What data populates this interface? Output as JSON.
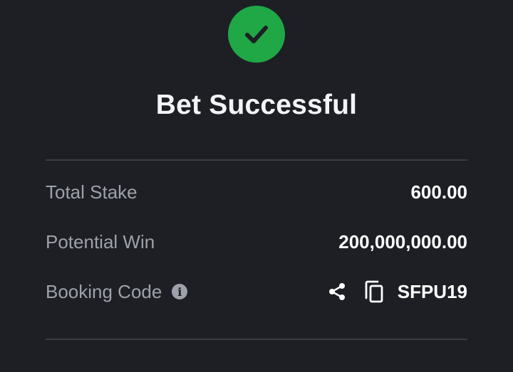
{
  "status": {
    "title": "Bet Successful",
    "icon": "check-circle-icon",
    "accent_color": "#1fa845"
  },
  "details": {
    "total_stake": {
      "label": "Total Stake",
      "value": "600.00"
    },
    "potential_win": {
      "label": "Potential Win",
      "value": "200,000,000.00"
    },
    "booking_code": {
      "label": "Booking Code",
      "value": "SFPU19",
      "info_icon": "info-icon",
      "share_icon": "share-icon",
      "copy_icon": "copy-icon"
    }
  }
}
